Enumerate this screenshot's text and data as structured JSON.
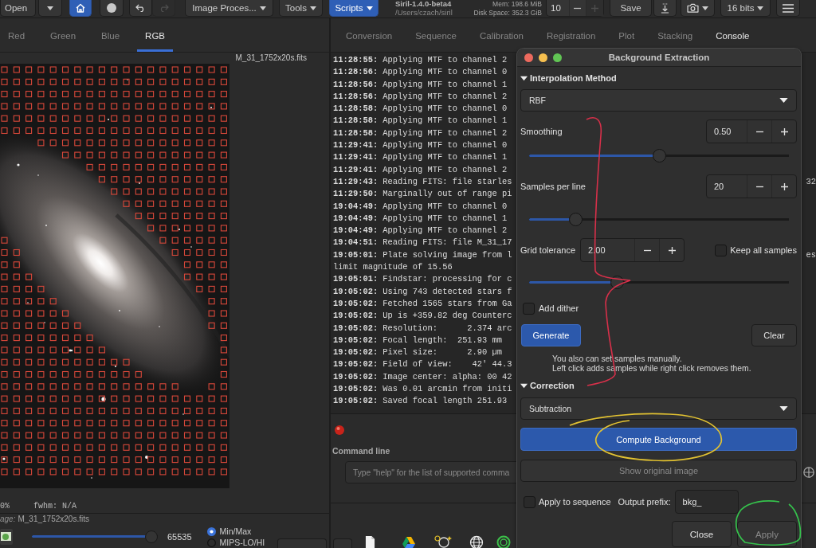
{
  "toolbar": {
    "open": "Open",
    "home_active": true,
    "history": [
      {
        "kind": "undo",
        "disabled": false
      },
      {
        "kind": "redo",
        "disabled": true
      }
    ],
    "menus": [
      {
        "label": "Image Proces...",
        "selected": false
      },
      {
        "label": "Tools",
        "selected": false
      },
      {
        "label": "Scripts",
        "selected": true
      }
    ],
    "app_title": "Siril-1.4.0-beta4",
    "app_path": "/Users/czach/siril",
    "memory": "Mem: 198.6 MiB",
    "disk": "Disk Space: 352.3 GiB",
    "spin": {
      "value": "10",
      "plus_disabled": true
    },
    "save": "Save",
    "bit_depth": "16 bits"
  },
  "left_panel": {
    "tabs": [
      {
        "label": "Red",
        "selected": false
      },
      {
        "label": "Green",
        "selected": false
      },
      {
        "label": "Blue",
        "selected": false
      },
      {
        "label": "RGB",
        "selected": true
      }
    ],
    "image_name": "M_31_1752x20s.fits",
    "zoom": "0%",
    "fwhm": "fwhm: N/A",
    "image_label": "age:",
    "image_file": "M_31_1752x20s.fits",
    "display": {
      "level": 1,
      "max_value": "65535",
      "modes": [
        {
          "label": "Min/Max",
          "selected": true
        },
        {
          "label": "MIPS-LO/HI",
          "selected": false
        }
      ]
    }
  },
  "console": {
    "tabs": [
      {
        "label": "Conversion",
        "selected": false
      },
      {
        "label": "Sequence",
        "selected": false
      },
      {
        "label": "Calibration",
        "selected": false
      },
      {
        "label": "Registration",
        "selected": false
      },
      {
        "label": "Plot",
        "selected": false
      },
      {
        "label": "Stacking",
        "selected": false
      },
      {
        "label": "Console",
        "selected": true
      }
    ],
    "lines": [
      {
        "text": "**11:28:55:** Applying MTF to channel 2"
      },
      {
        "text": "**11:28:56:** Applying MTF to channel 0"
      },
      {
        "text": "**11:28:56:** Applying MTF to channel 1"
      },
      {
        "text": "**11:28:56:** Applying MTF to channel 2"
      },
      {
        "text": "**11:28:58:** Applying MTF to channel 0"
      },
      {
        "text": "**11:28:58:** Applying MTF to channel 1"
      },
      {
        "text": "**11:28:58:** Applying MTF to channel 2"
      },
      {
        "text": "**11:29:41:** Applying MTF to channel 0"
      },
      {
        "text": "**11:29:41:** Applying MTF to channel 1"
      },
      {
        "text": "**11:29:41:** Applying MTF to channel 2"
      },
      {
        "text": "**11:29:43:** Reading FITS: file starles",
        "tail": "32"
      },
      {
        "text": "**11:29:50:** Marginally out of range pi"
      },
      {
        "text": "**19:04:49:** Applying MTF to channel 0"
      },
      {
        "text": "**19:04:49:** Applying MTF to channel 1"
      },
      {
        "text": "**19:04:49:** Applying MTF to channel 2"
      },
      {
        "text": "**19:04:51:** Reading FITS: file M_31_17"
      },
      {
        "text": "**19:05:01:** Plate solving image from l",
        "tail": "es"
      },
      {
        "text": "limit magnitude of 15.56"
      },
      {
        "text": "**19:05:01:** Findstar: processing for c"
      },
      {
        "text": "**19:05:02:** Using 743 detected stars f"
      },
      {
        "text": "**19:05:02:** Fetched 1565 stars from Ga"
      },
      {
        "text": "**19:05:02:** Up is +359.82 deg Counterc"
      },
      {
        "text": "**19:05:02:** Resolution:      2.374 arc"
      },
      {
        "text": "**19:05:02:** Focal length:  251.93 mm"
      },
      {
        "text": "**19:05:02:** Pixel size:      2.90 µm"
      },
      {
        "text": "**19:05:02:** Field of view:    42' 44.3"
      },
      {
        "text": "**19:05:02:** Image center: alpha: 00 42"
      },
      {
        "text": "**19:05:02:** Was 0.01 arcmin from initi"
      },
      {
        "text": "**19:05:02:** Saved focal length 251.93"
      }
    ],
    "command_label": "Command line",
    "command_placeholder": "Type \"help\" for the list of supported comma"
  },
  "dialog": {
    "title": "Background Extraction",
    "interpolation": {
      "heading": "Interpolation Method",
      "expanded": true,
      "method": "RBF"
    },
    "params": [
      {
        "label": "Smoothing",
        "value": "0.50",
        "level": 0.5
      },
      {
        "label": "Samples per line",
        "value": "20",
        "level": 0.16
      },
      {
        "label": "Grid tolerance",
        "value": "2.00",
        "level": 0.33,
        "option": {
          "label": "Keep all samples",
          "checked": false
        }
      }
    ],
    "add_dither": {
      "label": "Add dither",
      "checked": false
    },
    "generate": "Generate",
    "clear": "Clear",
    "hint": [
      "You also can set samples manually.",
      "Left click adds samples while right click removes them."
    ],
    "correction": {
      "heading": "Correction",
      "expanded": true,
      "method": "Subtraction"
    },
    "compute": "Compute Background",
    "show_original": {
      "label": "Show original image",
      "disabled": true
    },
    "apply_to_sequence": {
      "label": "Apply to sequence",
      "checked": false
    },
    "output_prefix": {
      "label": "Output prefix:",
      "value": "bkg_"
    },
    "buttons": [
      {
        "label": "Close",
        "disabled": false
      },
      {
        "label": "Apply",
        "disabled": true
      }
    ]
  }
}
